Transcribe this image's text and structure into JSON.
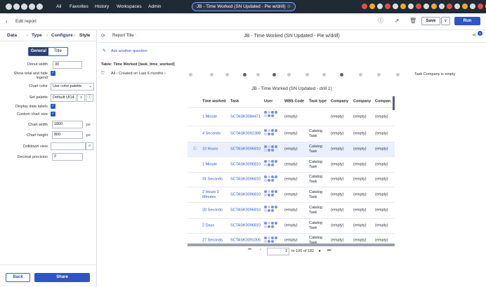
{
  "topnav": {
    "items": [
      "All",
      "Favorites",
      "History",
      "Workspaces",
      "Admin"
    ],
    "title": "JB - Time Worked (SN Updated - Pie w/drill)",
    "title_star": "☆"
  },
  "subheader": {
    "back": "‹",
    "label": "Edit report",
    "save": "Save",
    "dropdown": "∨",
    "run": "Run"
  },
  "left": {
    "tabs": [
      "Data",
      "Type",
      "Configure",
      "Style"
    ],
    "segments": [
      "General",
      "Title"
    ],
    "fields": {
      "donut_width_label": "Donut width",
      "donut_width": "30",
      "show_total_label": "Show total and hide legend",
      "chart_color_label": "Chart color",
      "chart_color": "Use color palette",
      "set_palette_label": "Set palette",
      "set_palette": "Default UI14",
      "display_labels_label": "Display data labels",
      "custom_size_label": "Custom chart size",
      "chart_width_label": "Chart width",
      "chart_width": "1800",
      "chart_height_label": "Chart height",
      "chart_height": "800",
      "px": "px",
      "drilldown_label": "Drilldown view",
      "drilldown": "",
      "decimal_label": "Decimal precision",
      "decimal": "2"
    },
    "back_button": "Back",
    "share_button": "Share"
  },
  "report": {
    "title_label": "Report Title :",
    "title": "JB - Time Worked (SN Updated - Pie w/drill)",
    "ask": "Ask another question",
    "table": "Table: Time Worked [task_time_worked]",
    "filter_all": "All",
    "filter_created": "Created on Last 6 months",
    "filter_company": "Task Company is empty",
    "chart_title": "JB - Time Worked (SN Updated - drill 1)",
    "columns": [
      "Time worked",
      "Task",
      "User",
      "WBS Code",
      "Task type",
      "Company",
      "Company",
      "Compan"
    ],
    "rows": [
      {
        "time": "1 Minute",
        "task": "SCTASK0084471",
        "wbs": "(empty)",
        "type": "",
        "c1": "(empty)",
        "c2": "(empty)",
        "c3": "(empty)"
      },
      {
        "time": "4 Seconds",
        "task": "SCTASK0092388",
        "wbs": "(empty)",
        "type": "Catalog Task",
        "c1": "(empty)",
        "c2": "(empty)",
        "c3": "(empty)"
      },
      {
        "time": "10 Hours",
        "task": "SCTASK0096810",
        "wbs": "(empty)",
        "type": "Catalog Task",
        "c1": "(empty)",
        "c2": "(empty)",
        "c3": "(empty)"
      },
      {
        "time": "1 Minute",
        "task": "SCTASK0096810",
        "wbs": "(empty)",
        "type": "Catalog Task",
        "c1": "(empty)",
        "c2": "(empty)",
        "c3": "(empty)"
      },
      {
        "time": "31 Seconds",
        "task": "SCTASK0096810",
        "wbs": "(empty)",
        "type": "Catalog Task",
        "c1": "(empty)",
        "c2": "(empty)",
        "c3": "(empty)"
      },
      {
        "time": "2 Hours 3 Minutes",
        "task": "SCTASK0096810",
        "wbs": "(empty)",
        "type": "Catalog Task",
        "c1": "(empty)",
        "c2": "(empty)",
        "c3": "(empty)"
      },
      {
        "time": "20 Seconds",
        "task": "SCTASK0096810",
        "wbs": "(empty)",
        "type": "Catalog Task",
        "c1": "(empty)",
        "c2": "(empty)",
        "c3": "(empty)"
      },
      {
        "time": "2 Days",
        "task": "SCTASK0096810",
        "wbs": "(empty)",
        "type": "Catalog Task",
        "c1": "(empty)",
        "c2": "(empty)",
        "c3": "(empty)"
      },
      {
        "time": "27 Seconds",
        "task": "SCTASK0091005",
        "wbs": "(empty)",
        "type": "Catalog Task",
        "c1": "(empty)",
        "c2": "(empty)",
        "c3": "(empty)"
      }
    ],
    "pager": {
      "first": "⏮",
      "prev": "‹",
      "current": "1",
      "text": "to 100 of 182",
      "next": "▸",
      "last": "⏭"
    }
  },
  "colors": {
    "accent": "#2d55c7",
    "nav": "#1f2a35"
  }
}
